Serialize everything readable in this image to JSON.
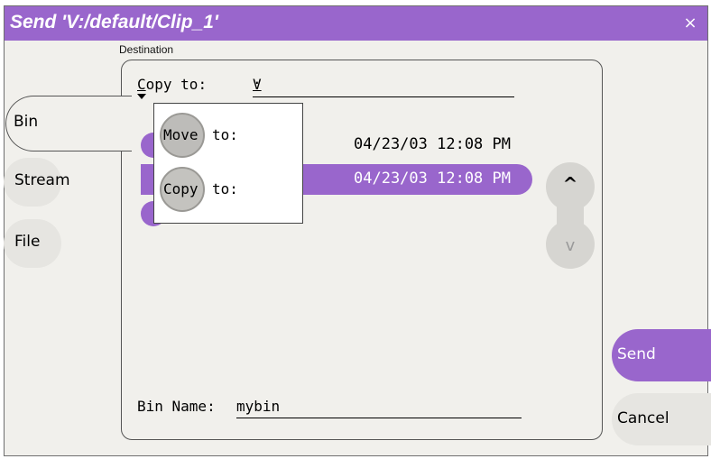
{
  "window": {
    "title": "Send 'V:/default/Clip_1'",
    "close_glyph": "×"
  },
  "destination": {
    "label": "Destination"
  },
  "tabs": [
    {
      "label": "Bin",
      "active": true
    },
    {
      "label": "Stream",
      "active": false
    },
    {
      "label": "File",
      "active": false
    }
  ],
  "copy_mode": {
    "selected_prefix": "C",
    "selected_rest": "opy to:"
  },
  "target": {
    "prefix": "V",
    "rest": ":"
  },
  "rows": [
    {
      "date": "04/23/03 12:08 PM",
      "selected": false
    },
    {
      "date": "04/23/03 12:08 PM",
      "selected": true
    },
    {
      "date": "",
      "selected": false
    }
  ],
  "dropdown": {
    "options": [
      {
        "circle_text": "Move",
        "rest": " to:"
      },
      {
        "circle_text": "Copy",
        "rest": " to:"
      }
    ]
  },
  "bin_name": {
    "label": "Bin Name:",
    "value": "mybin"
  },
  "scroll": {
    "up_glyph": "^",
    "down_glyph": "v"
  },
  "buttons": {
    "send": "Send",
    "cancel": "Cancel"
  },
  "colors": {
    "accent": "#9966cc",
    "background": "#f1f0ec",
    "control": "#e6e5e1"
  }
}
